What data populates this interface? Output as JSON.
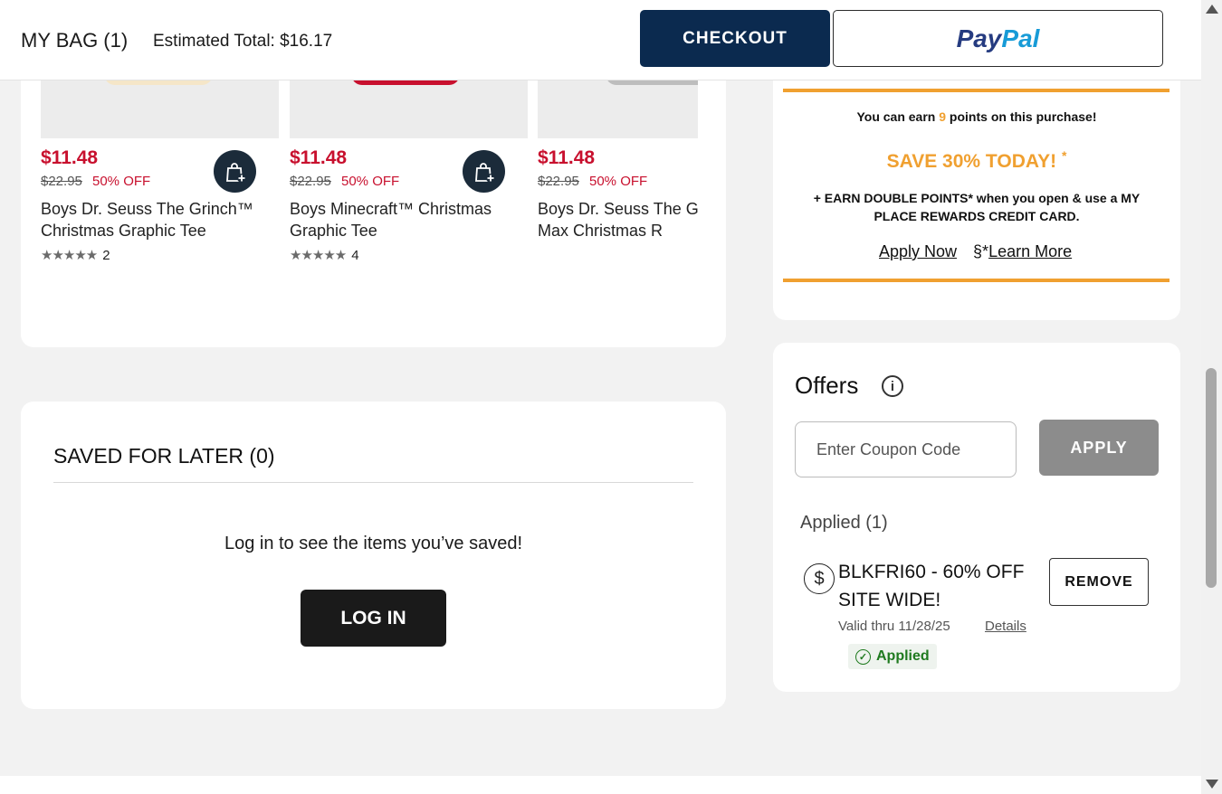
{
  "header": {
    "bag_title": "MY BAG (1)",
    "estimated_total": "Estimated Total: $16.17",
    "checkout_label": "CHECKOUT",
    "paypal_a": "Pay",
    "paypal_b": "Pal"
  },
  "recommendations": [
    {
      "price": "$11.48",
      "original": "$22.95",
      "discount": "50% OFF",
      "name": "Boys Dr. Seuss The Grinch™ Christmas Graphic Tee",
      "rating_count": "2",
      "image_accent": "#f5e6c8"
    },
    {
      "price": "$11.48",
      "original": "$22.95",
      "discount": "50% OFF",
      "name": "Boys Minecraft™ Christmas Graphic Tee",
      "rating_count": "4",
      "image_accent": "#c8102e"
    },
    {
      "price": "$11.48",
      "original": "$22.95",
      "discount": "50% OFF",
      "name": "Boys Dr. Seuss The Grinch And Max Christmas R",
      "rating_count": "",
      "image_accent": "#bdbdbd"
    }
  ],
  "saved": {
    "title": "SAVED FOR LATER (0)",
    "message": "Log in to see the items you’ve saved!",
    "login_label": "LOG IN"
  },
  "promo": {
    "earn_pre": "You can earn ",
    "earn_points": "9",
    "earn_post": " points on this purchase!",
    "save_today": "SAVE 30% TODAY!",
    "save_mark": "*",
    "double_points": "+ EARN DOUBLE POINTS* when you open & use a MY PLACE REWARDS CREDIT CARD.",
    "apply_now": "Apply Now",
    "learn_prefix": "§*",
    "learn_more": "Learn More",
    "accent_color": "#f0a030"
  },
  "offers": {
    "title": "Offers",
    "info_icon": "i",
    "coupon_placeholder": "Enter Coupon Code",
    "apply_label": "APPLY",
    "applied_heading": "Applied (1)",
    "coupon_name": "BLKFRI60 - 60% OFF SITE WIDE!",
    "valid_thru": "Valid thru 11/28/25",
    "details_label": "Details",
    "applied_badge": "Applied",
    "remove_label": "REMOVE"
  },
  "colors": {
    "brand_navy": "#0b2a4f",
    "sale_red": "#c8102e",
    "applied_green": "#1f7a1f"
  }
}
